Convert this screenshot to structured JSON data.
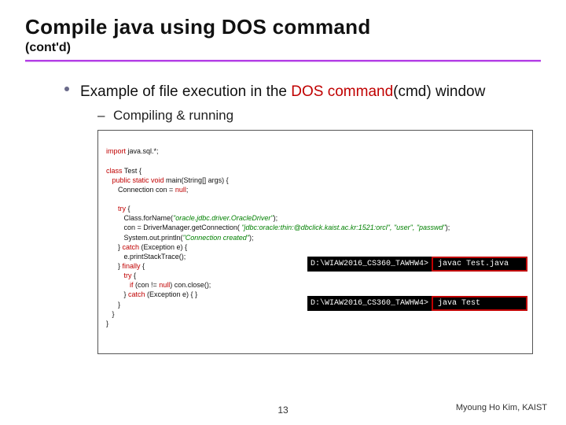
{
  "header": {
    "title": "Compile java using DOS command",
    "subtitle": "(cont'd)"
  },
  "bullet": {
    "prefix": "Example of file execution in the ",
    "emph": "DOS command",
    "suffix": "(cmd) window"
  },
  "subbullet": {
    "dash": "–",
    "text": "Compiling & running"
  },
  "code": {
    "l1a": "import",
    "l1b": " java.sql.*;",
    "l2": "",
    "l3a": "class",
    "l3b": " Test {",
    "l4a": "   public static void",
    "l4b": " main(String[] args) {",
    "l5a": "      Connection con = ",
    "l5b": "null",
    "l5c": ";",
    "l6": "",
    "l7a": "      try",
    "l7b": " {",
    "l8a": "         Class.forName(",
    "l8b": "\"oracle.jdbc.driver.OracleDriver\"",
    "l8c": ");",
    "l9a": "         con = DriverManager.getConnection( ",
    "l9b": "\"jdbc:oracle:thin:@dbclick.kaist.ac.kr:1521:orcl\", \"user\", \"passwd\"",
    "l9c": ");",
    "l10a": "         System.out.println(",
    "l10b": "\"Connection created\"",
    "l10c": ");",
    "l11a": "      } ",
    "l11b": "catch",
    "l11c": " (Exception e) {",
    "l12": "         e.printStackTrace();",
    "l13a": "      } ",
    "l13b": "finally",
    "l13c": " {",
    "l14a": "         try",
    "l14b": " {",
    "l15a": "            if",
    "l15b": " (con != ",
    "l15c": "null",
    "l15d": ") con.close();",
    "l16a": "         } ",
    "l16b": "catch",
    "l16c": " (Exception e) { }",
    "l17": "      }",
    "l18": "   }",
    "l19": "}"
  },
  "cmd": {
    "prompt1": "D:\\WIAW2016_CS360_TAWHW4>",
    "input1": "javac Test.java",
    "prompt2": "D:\\WIAW2016_CS360_TAWHW4>",
    "input2": "java Test"
  },
  "footer": {
    "page": "13",
    "credit": "Myoung Ho Kim, KAIST"
  }
}
